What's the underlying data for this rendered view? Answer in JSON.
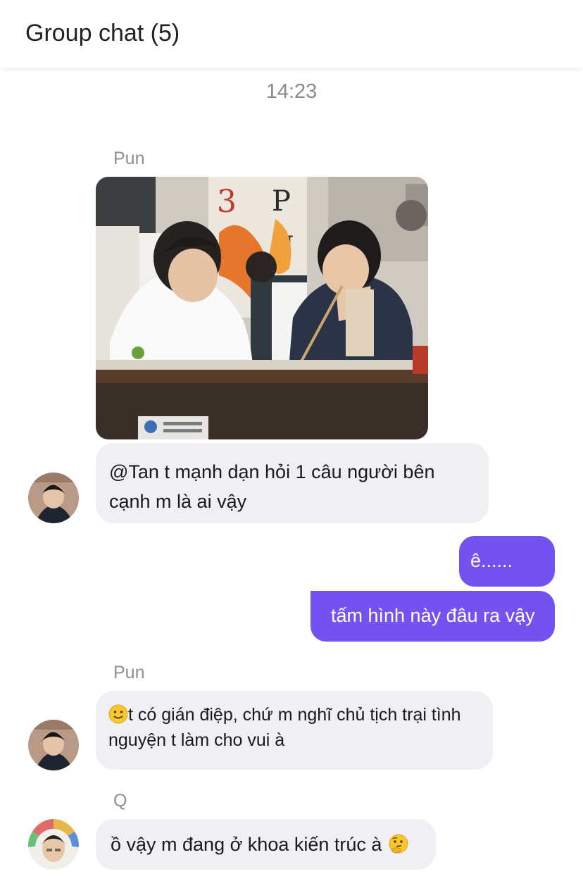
{
  "header": {
    "title": "Group chat (5)"
  },
  "timestamp": "14:23",
  "messages": [
    {
      "sender": "Pun",
      "photo_label": "photo message: two students at a classroom desk",
      "text": "@Tan t mạnh dạn hỏi 1 câu người bên cạnh m là ai vậy"
    },
    {
      "outgoing_1": "ê......",
      "outgoing_2": "tấm hình này đâu ra vậy"
    },
    {
      "sender": "Pun",
      "emoji": "slightly-smiling-face-icon",
      "text": "t có gián điệp, chứ m nghĩ chủ tịch trại tình nguyện t làm cho vui à"
    },
    {
      "sender": "Q",
      "text": "ồ vậy m đang ở khoa kiến trúc à",
      "emoji": "thinking-face-icon"
    }
  ],
  "colors": {
    "outgoing_bubble": "#7452f0",
    "incoming_bubble": "#efeff4",
    "sender_name": "#8e8e8e"
  }
}
